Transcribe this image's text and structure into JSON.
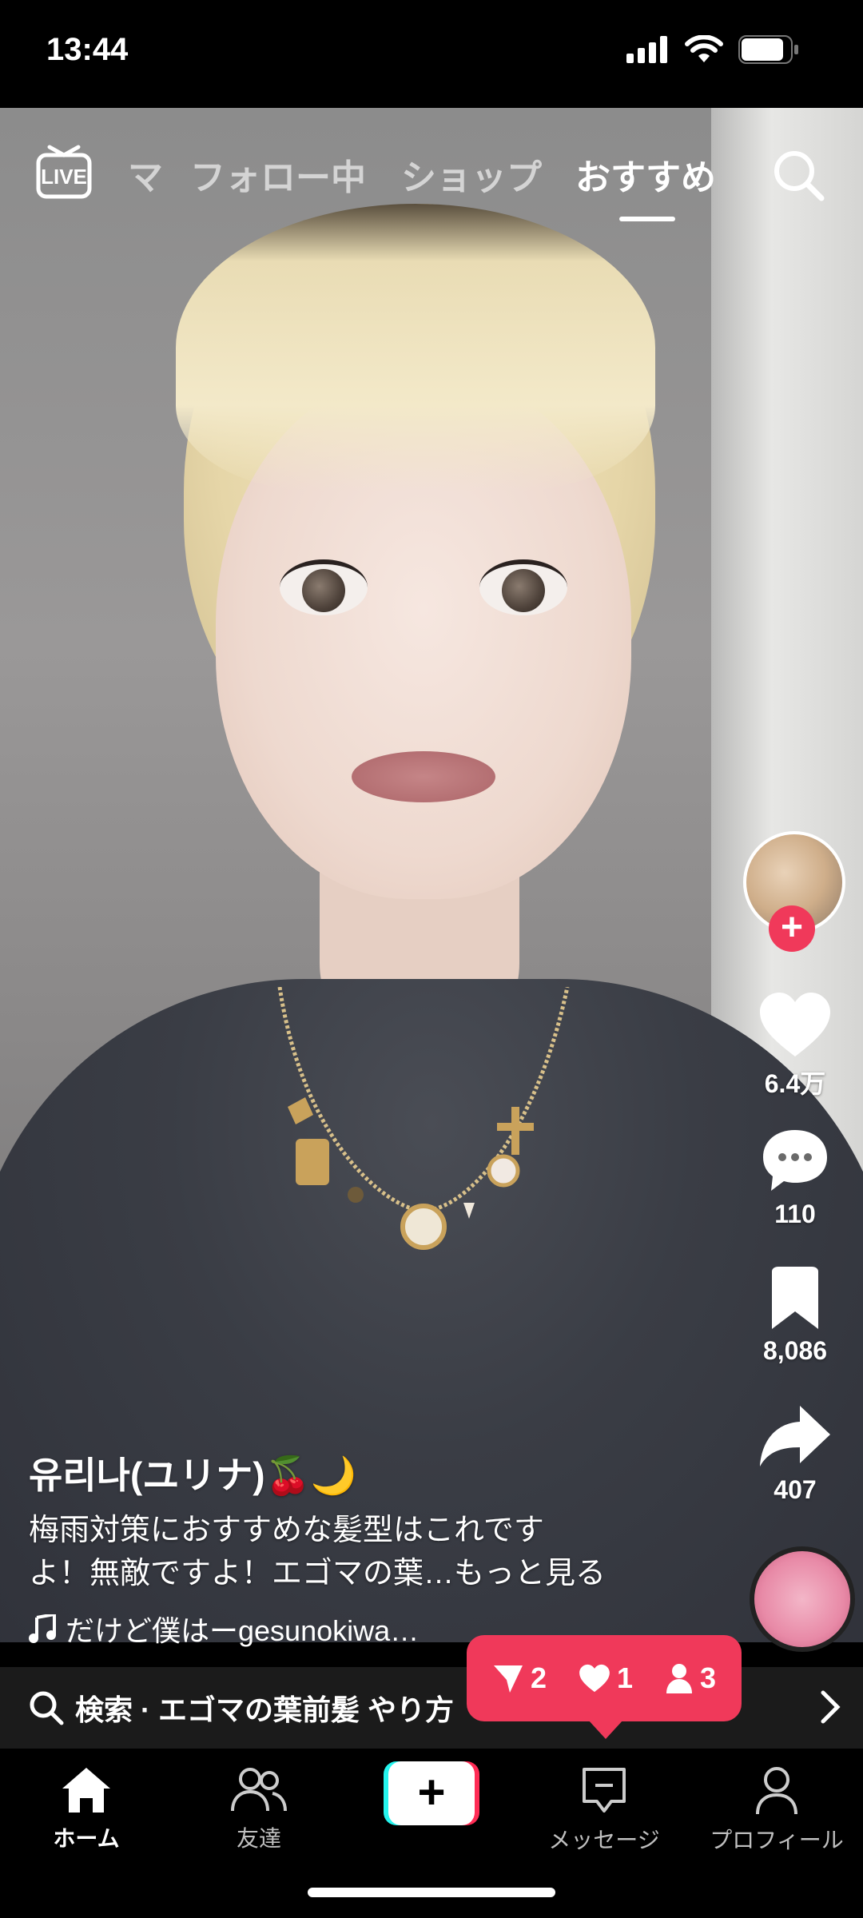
{
  "status_bar": {
    "time": "13:44"
  },
  "top_nav": {
    "live_label": "LIVE",
    "tabs": [
      {
        "label": "マ"
      },
      {
        "label": "フォロー中"
      },
      {
        "label": "ショップ"
      },
      {
        "label": "おすすめ",
        "active": true
      }
    ]
  },
  "actions": {
    "likes": "6.4万",
    "comments": "110",
    "saves": "8,086",
    "shares": "407"
  },
  "post": {
    "username": "유리나(ユリナ)🍒🌙",
    "caption_line1": "梅雨対策におすすめな髪型はこれです",
    "caption_line2": "よ！無敵ですよ！エゴマの葉…もっと見る",
    "music": "だけど僕はーgesunokiwa…"
  },
  "search_suggestion": {
    "text": "検索 · エゴマの葉前髪 やり方"
  },
  "notifications": {
    "shares": "2",
    "likes": "1",
    "followers": "3"
  },
  "bottom_tabs": [
    {
      "label": "ホーム",
      "active": true
    },
    {
      "label": "友達"
    },
    {
      "label": "+"
    },
    {
      "label": "メッセージ"
    },
    {
      "label": "プロフィール"
    }
  ],
  "colors": {
    "accent": "#f0395a",
    "cyan": "#25f4ee",
    "red": "#fe2c55"
  }
}
